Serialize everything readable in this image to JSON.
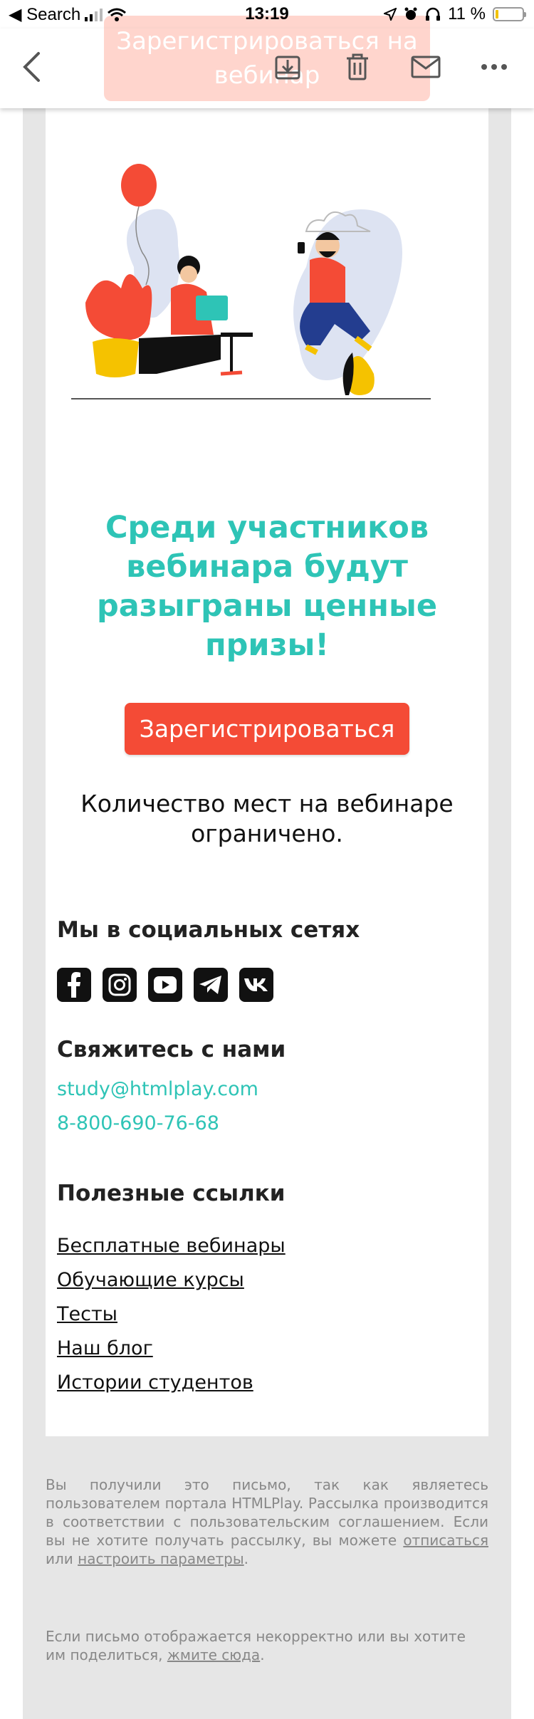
{
  "status_bar": {
    "back_label": "◀ Search",
    "time": "13:19",
    "battery_text": "11 %"
  },
  "toolbar": {
    "ghost_button_text": "Зарегистрироваться на вебинар"
  },
  "email": {
    "headline": "Среди участников вебинара будут разыграны ценные призы!",
    "cta_label": "Зарегистрироваться",
    "seats_text": "Количество мест на вебинаре ограничено.",
    "social_heading": "Мы в социальных сетях",
    "social_icons": [
      "facebook-icon",
      "instagram-icon",
      "youtube-icon",
      "telegram-icon",
      "vk-icon"
    ],
    "contact_heading": "Свяжитесь с нами",
    "contact_email": "study@htmlplay.com",
    "contact_phone": "8-800-690-76-68",
    "links_heading": "Полезные ссылки",
    "links": [
      "Бесплатные вебинары",
      "Обучающие курсы",
      "Тесты",
      "Наш блог",
      "Истории студентов"
    ]
  },
  "footer": {
    "p1_text": "Вы получили это письмо, так как являетесь пользователем портала HTMLPlay. Рассылка производится в соответствии с пользовательским соглашением. Если вы не хотите получать рассылку, вы можете",
    "unsubscribe": "отписаться",
    "or": "или",
    "settings": "настроить параметры",
    "p2_text": "Если письмо отображается некорректно или вы хотите им поделиться,",
    "click_here": "жмите сюда"
  },
  "colors": {
    "accent_teal": "#2ec4b6",
    "cta_red": "#f44b36",
    "frame_gray": "#e6e6e6"
  }
}
